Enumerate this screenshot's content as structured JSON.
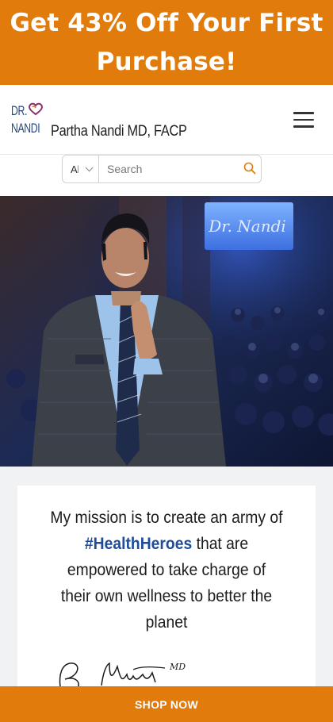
{
  "promo": {
    "text": "Get 43% Off Your First Purchase!"
  },
  "header": {
    "logo_line1": "DR.",
    "logo_line2": "NANDI",
    "site_name": "Partha Nandi MD, FACP",
    "menu_icon": "hamburger-menu-icon"
  },
  "search": {
    "category": "All",
    "placeholder": "Search",
    "icon": "search-icon"
  },
  "hero": {
    "icon": "hero-photo",
    "screen_text": "Dr. Nandi"
  },
  "mission": {
    "part1": "My mission is to create an army of",
    "hashtag": "#HealthHeroes",
    "part2": "that are empowered to take charge of their own wellness to better the planet"
  },
  "signature": {
    "suffix": "MD"
  },
  "cta": {
    "label": "SHOP NOW"
  },
  "colors": {
    "accent": "#e07b0c",
    "brand_blue": "#24467f",
    "hashtag_blue": "#1f4d9a"
  }
}
